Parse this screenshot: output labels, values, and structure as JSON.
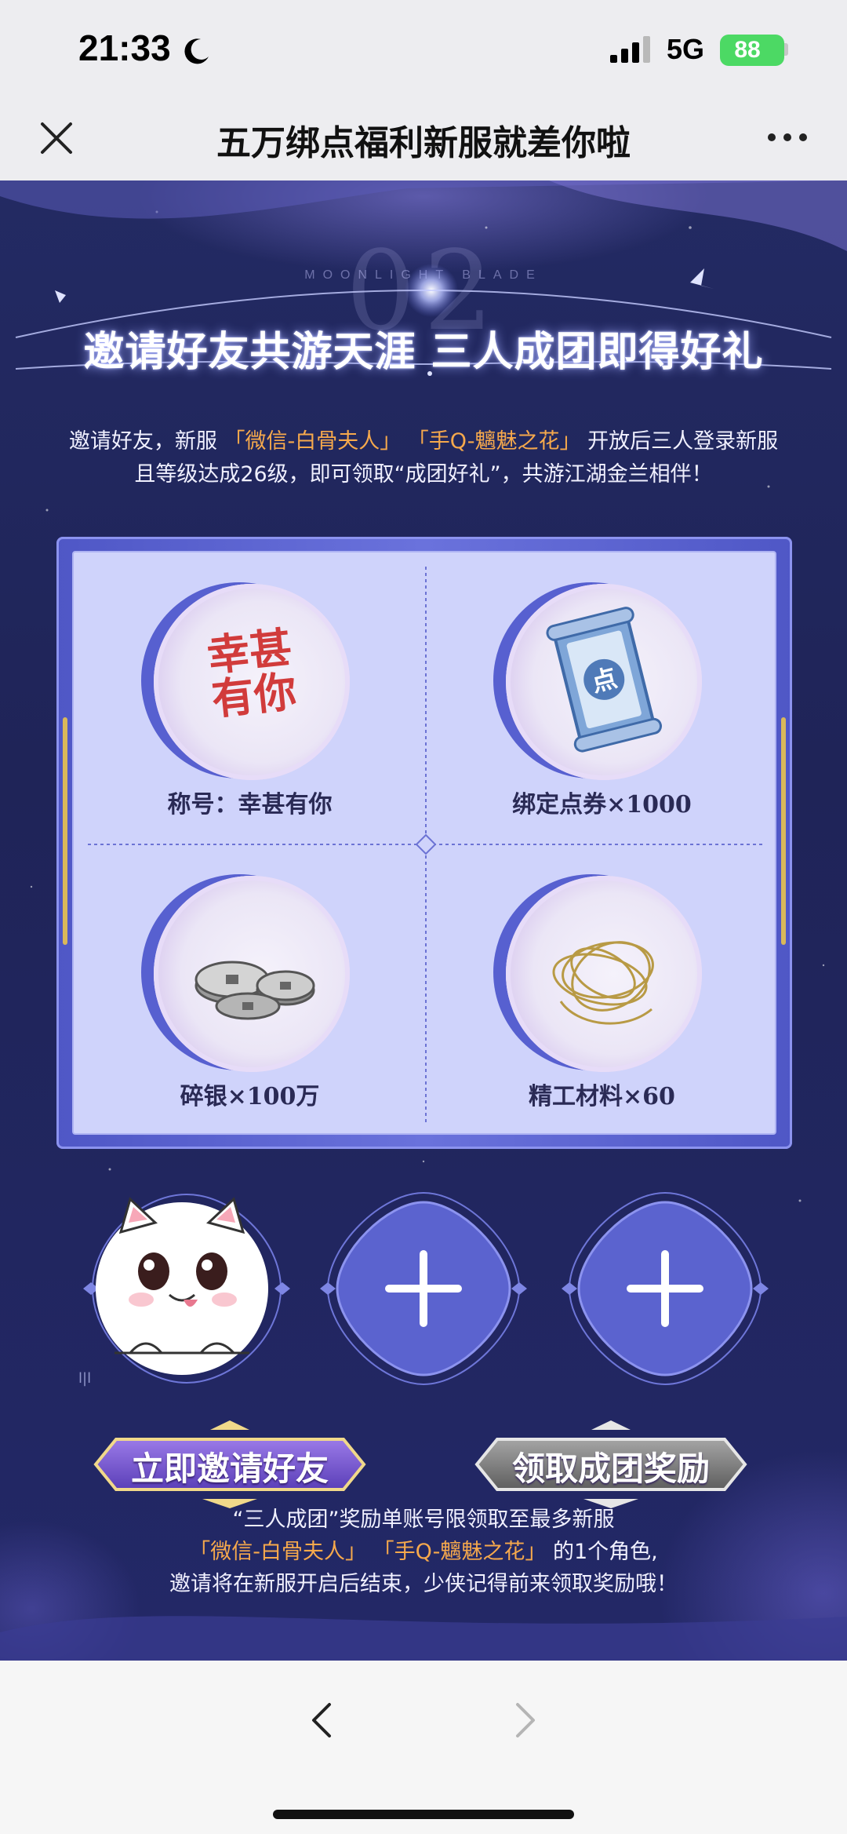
{
  "status_bar": {
    "time": "21:33",
    "network": "5G",
    "battery": "88",
    "icons": [
      "moon-icon",
      "signal-icon",
      "battery-icon"
    ]
  },
  "nav": {
    "title": "五万绑点福利新服就差你啦",
    "close_icon": "close-icon",
    "more_icon": "more-icon"
  },
  "banner": {
    "number": "02",
    "game_name": "MOONLIGHT BLADE",
    "headline": "邀请好友共游天涯 三人成团即得好礼"
  },
  "intro": {
    "part1": "邀请好友，新服",
    "server1": "「微信-白骨夫人」",
    "server2": "「手Q-魑魅之花」",
    "part2": "开放后三人登录新服",
    "line2": "且等级达成26级，即可领取“成团好礼”，共游江湖金兰相伴！"
  },
  "rewards": [
    {
      "label": "称号：幸甚有你",
      "art_text": "幸甚\n有你",
      "icon": "title-seal-icon"
    },
    {
      "label": "绑定点券×1000",
      "icon": "scroll-icon"
    },
    {
      "label": "碎银×100万",
      "icon": "coins-icon"
    },
    {
      "label": "精工材料×60",
      "icon": "thread-icon"
    }
  ],
  "team": {
    "member_name": "l|l",
    "slots": [
      "avatar",
      "add-friend",
      "add-friend"
    ]
  },
  "buttons": {
    "invite": "立即邀请好友",
    "claim": "领取成团奖励"
  },
  "notice": {
    "line1": "“三人成团”奖励单账号限领取至最多新服",
    "server1": "「微信-白骨夫人」",
    "server2": "「手Q-魑魅之花」",
    "line2_tail": "的1个角色,",
    "line3": "邀请将在新服开启后结束，少侠记得前来领取奖励哦！"
  },
  "colors": {
    "page_bg": "#232a63",
    "highlight": "#f6a94c",
    "card_bg": "#cfd3fb",
    "accent": "#5760d0"
  }
}
